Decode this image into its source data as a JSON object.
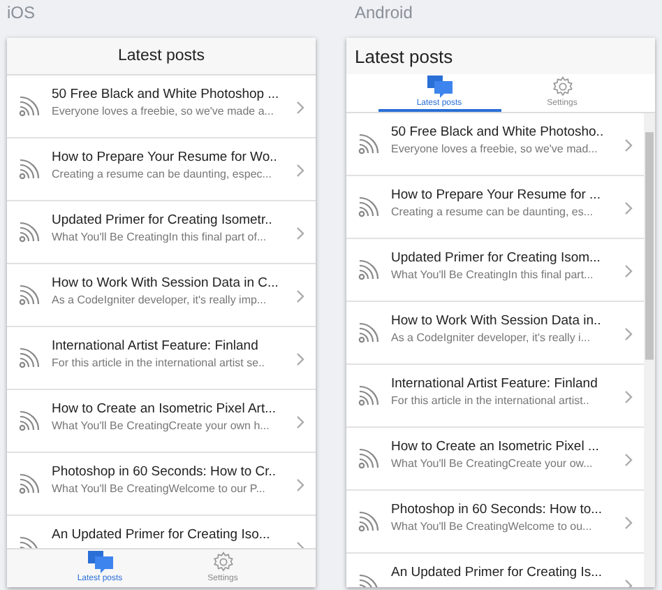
{
  "panels": [
    {
      "platform": "iOS",
      "kind": "ios",
      "header": "Latest posts",
      "tabs": [
        {
          "label": "Latest posts",
          "kind": "chat",
          "selected": true
        },
        {
          "label": "Settings",
          "kind": "gear",
          "selected": false
        }
      ],
      "posts": [
        {
          "title": "50 Free Black and White Photoshop ...",
          "summary": "Everyone loves a freebie, so we've made a..."
        },
        {
          "title": "How to Prepare Your Resume for Wo..",
          "summary": "Creating a resume can be daunting, espec..."
        },
        {
          "title": "Updated Primer for Creating Isometr..",
          "summary": "What You'll Be CreatingIn this final part of..."
        },
        {
          "title": "How to Work With Session Data in C...",
          "summary": "As a CodeIgniter developer, it's really imp..."
        },
        {
          "title": "International Artist Feature: Finland",
          "summary": "For this article in the international artist se.."
        },
        {
          "title": "How to Create an Isometric Pixel Art...",
          "summary": "What You'll Be CreatingCreate your own h..."
        },
        {
          "title": "Photoshop in 60 Seconds: How to Cr..",
          "summary": "What You'll Be CreatingWelcome to our P..."
        },
        {
          "title": "An Updated Primer for Creating Iso..."
        }
      ]
    },
    {
      "platform": "Android",
      "kind": "android",
      "header": "Latest posts",
      "tabs": [
        {
          "label": "Latest posts",
          "kind": "chat",
          "selected": true
        },
        {
          "label": "Settings",
          "kind": "gear",
          "selected": false
        }
      ],
      "posts": [
        {
          "title": "50 Free Black and White Photosho..",
          "summary": "Everyone loves a freebie, so we've mad..."
        },
        {
          "title": "How to Prepare Your Resume for ...",
          "summary": "Creating a resume can be daunting, es..."
        },
        {
          "title": "Updated Primer for Creating Isom...",
          "summary": "What You'll Be CreatingIn this final part..."
        },
        {
          "title": "How to Work With Session Data in..",
          "summary": "As a CodeIgniter developer, it's really i..."
        },
        {
          "title": "International Artist Feature: Finland",
          "summary": "For this article in the international artist.."
        },
        {
          "title": "How to Create an Isometric Pixel ...",
          "summary": "What You'll Be CreatingCreate your ow..."
        },
        {
          "title": "Photoshop in 60 Seconds: How to...",
          "summary": "What You'll Be CreatingWelcome to ou..."
        },
        {
          "title": "An Updated Primer for Creating Is..."
        }
      ]
    }
  ]
}
